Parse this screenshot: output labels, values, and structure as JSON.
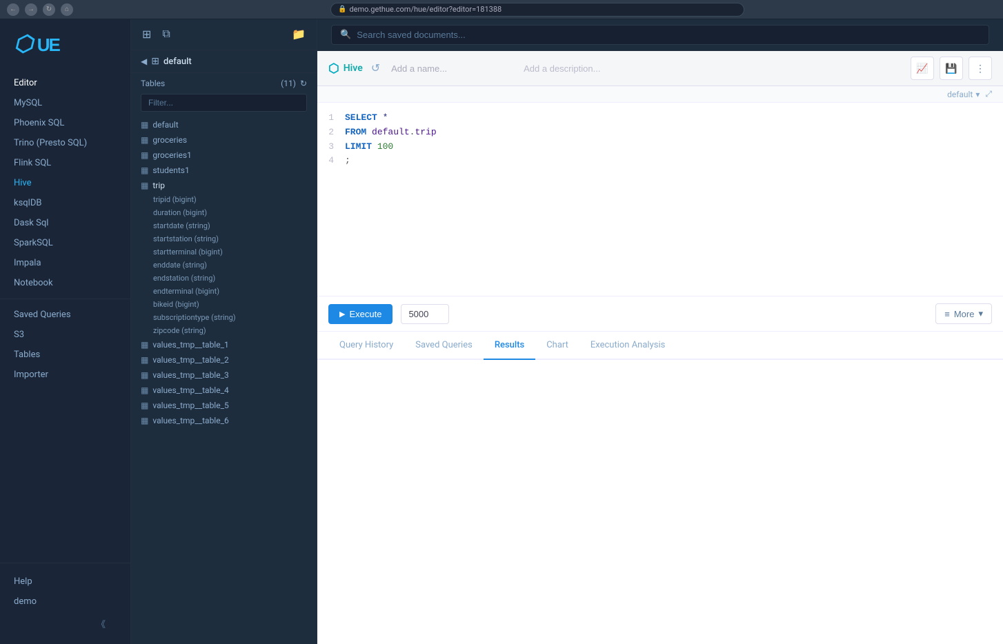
{
  "browser": {
    "url": "demo.gethue.com/hue/editor?editor=181388",
    "lock": "🔒"
  },
  "logo": {
    "text": "HUE",
    "icon": "⬡"
  },
  "sidebar": {
    "active_section": "Editor",
    "items": [
      {
        "id": "editor",
        "label": "Editor"
      },
      {
        "id": "mysql",
        "label": "MySQL"
      },
      {
        "id": "phoenix",
        "label": "Phoenix SQL"
      },
      {
        "id": "trino",
        "label": "Trino (Presto SQL)"
      },
      {
        "id": "flink",
        "label": "Flink SQL"
      },
      {
        "id": "hive",
        "label": "Hive"
      },
      {
        "id": "ksqldb",
        "label": "ksqlDB"
      },
      {
        "id": "dask",
        "label": "Dask Sql"
      },
      {
        "id": "sparksql",
        "label": "SparkSQL"
      },
      {
        "id": "impala",
        "label": "Impala"
      },
      {
        "id": "notebook",
        "label": "Notebook"
      }
    ],
    "saved_queries": "Saved Queries",
    "s3": "S3",
    "tables": "Tables",
    "importer": "Importer",
    "help": "Help",
    "demo": "demo"
  },
  "middle_panel": {
    "db_name": "default",
    "tables_label": "Tables",
    "tables_count": "(11)",
    "filter_placeholder": "Filter...",
    "tables": [
      {
        "name": "default",
        "icon": "▦"
      },
      {
        "name": "groceries",
        "icon": "▦"
      },
      {
        "name": "groceries1",
        "icon": "▦"
      },
      {
        "name": "students1",
        "icon": "▦"
      },
      {
        "name": "trip",
        "icon": "▦"
      },
      {
        "name": "values_tmp__table_1",
        "icon": "▦"
      },
      {
        "name": "values_tmp__table_2",
        "icon": "▦"
      },
      {
        "name": "values_tmp__table_3",
        "icon": "▦"
      },
      {
        "name": "values_tmp__table_4",
        "icon": "▦"
      },
      {
        "name": "values_tmp__table_5",
        "icon": "▦"
      },
      {
        "name": "values_tmp__table_6",
        "icon": "▦"
      }
    ],
    "trip_fields": [
      "tripid (bigint)",
      "duration (bigint)",
      "startdate (string)",
      "startstation (string)",
      "startterminal (bigint)",
      "enddate (string)",
      "endstation (string)",
      "endterminal (bigint)",
      "bikeid (bigint)",
      "subscriptiontype (string)",
      "zipcode (string)"
    ]
  },
  "search": {
    "placeholder": "Search saved documents..."
  },
  "editor_toolbar": {
    "hive_label": "Hive",
    "name_placeholder": "Add a name...",
    "desc_placeholder": "Add a description...",
    "default_label": "default"
  },
  "code": {
    "lines": [
      {
        "num": "1",
        "content": "SELECT *"
      },
      {
        "num": "2",
        "content": "FROM default.trip"
      },
      {
        "num": "3",
        "content": "LIMIT 100"
      },
      {
        "num": "4",
        "content": ";"
      }
    ]
  },
  "execute_bar": {
    "button_label": "Execute",
    "limit_value": "5000",
    "more_label": "More"
  },
  "tabs": [
    {
      "id": "query-history",
      "label": "Query History"
    },
    {
      "id": "saved-queries",
      "label": "Saved Queries"
    },
    {
      "id": "results",
      "label": "Results",
      "active": true
    },
    {
      "id": "chart",
      "label": "Chart"
    },
    {
      "id": "execution-analysis",
      "label": "Execution Analysis"
    }
  ]
}
